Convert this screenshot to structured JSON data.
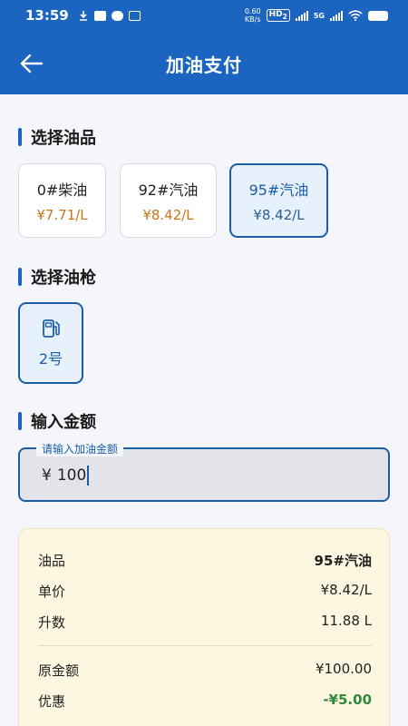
{
  "status_bar": {
    "time": "13:59",
    "network_speed_value": "0.60",
    "network_speed_unit": "KB/s",
    "hd_label": "HD",
    "sim2": "2",
    "network_type": "5G"
  },
  "header": {
    "title": "加油支付"
  },
  "sections": {
    "fuel_title": "选择油品",
    "nozzle_title": "选择油枪",
    "amount_title": "输入金额"
  },
  "fuels": [
    {
      "name": "0#柴油",
      "price": "¥7.71/L",
      "selected": false
    },
    {
      "name": "92#汽油",
      "price": "¥8.42/L",
      "selected": false
    },
    {
      "name": "95#汽油",
      "price": "¥8.42/L",
      "selected": true
    }
  ],
  "nozzles": [
    {
      "label": "2号",
      "selected": true
    }
  ],
  "amount_input": {
    "floating_label": "请输入加油金额",
    "currency": "¥",
    "value": "100"
  },
  "summary": {
    "fuel_label": "油品",
    "fuel_value": "95#汽油",
    "unit_price_label": "单价",
    "unit_price_value": "¥8.42/L",
    "liters_label": "升数",
    "liters_value": "11.88 L",
    "original_label": "原金额",
    "original_value": "¥100.00",
    "discount_label": "优惠",
    "discount_value": "-¥5.00"
  },
  "colors": {
    "primary": "#1b64c0",
    "price_orange": "#c7761a",
    "discount_green": "#2e8b3a",
    "summary_bg": "#fdf6e1"
  }
}
